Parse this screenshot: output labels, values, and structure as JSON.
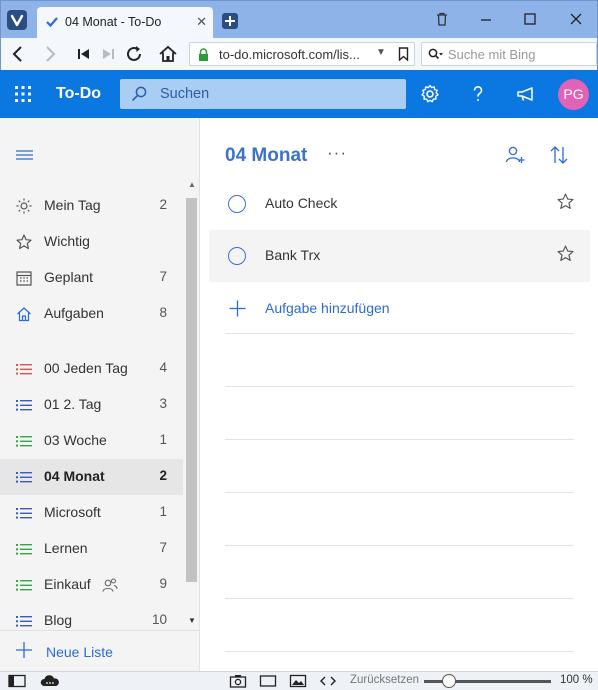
{
  "browser": {
    "tab_title": "04 Monat - To-Do",
    "url": "to-do.microsoft.com/lis...",
    "search_placeholder": "Suche mit Bing"
  },
  "app": {
    "title": "To-Do",
    "search_placeholder": "Suchen",
    "avatar_initials": "PG",
    "accent": "#0a78e0",
    "avatar_color": "#e163b8"
  },
  "sidebar": {
    "items": [
      {
        "label": "Mein Tag",
        "count": "2",
        "icon": "sun-icon"
      },
      {
        "label": "Wichtig",
        "count": "",
        "icon": "star-icon"
      },
      {
        "label": "Geplant",
        "count": "7",
        "icon": "calendar-icon"
      },
      {
        "label": "Aufgaben",
        "count": "8",
        "icon": "home-icon"
      }
    ],
    "lists": [
      {
        "label": "00 Jeden Tag",
        "count": "4",
        "color": "#d9534f"
      },
      {
        "label": "01 2. Tag",
        "count": "3",
        "color": "#3b5bc0"
      },
      {
        "label": "03 Woche",
        "count": "1",
        "color": "#3aa34a"
      },
      {
        "label": "04 Monat",
        "count": "2",
        "color": "#3b5bc0",
        "active": true
      },
      {
        "label": "Microsoft",
        "count": "1",
        "color": "#3b5bc0"
      },
      {
        "label": "Lernen",
        "count": "7",
        "color": "#3aa34a"
      },
      {
        "label": "Einkauf",
        "count": "9",
        "color": "#3aa34a",
        "shared": true
      },
      {
        "label": "Blog",
        "count": "10",
        "color": "#3b5bc0"
      }
    ],
    "new_list_label": "Neue Liste"
  },
  "main": {
    "list_title": "04 Monat",
    "more_label": "···",
    "tasks": [
      {
        "title": "Auto Check"
      },
      {
        "title": "Bank Trx"
      }
    ],
    "add_task_label": "Aufgabe hinzufügen"
  },
  "statusbar": {
    "reset_label": "Zurücksetzen",
    "zoom": "100 %"
  }
}
